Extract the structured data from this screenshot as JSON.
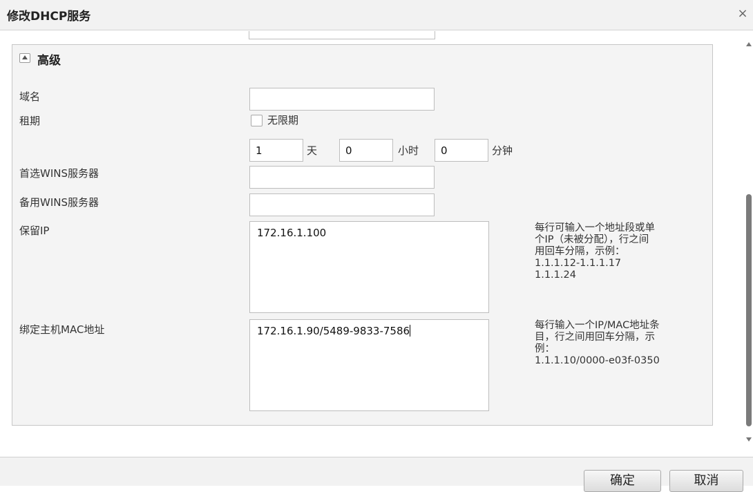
{
  "dialog": {
    "title": "修改DHCP服务",
    "close_glyph": "×"
  },
  "section": {
    "title": "高级",
    "toggle_icon": "collapse-triangle-icon"
  },
  "fields": {
    "domain": {
      "label": "域名",
      "value": ""
    },
    "lease": {
      "label": "租期",
      "unlimited_label": "无限期",
      "unlimited_checked": false,
      "days": "1",
      "days_unit": "天",
      "hours": "0",
      "hours_unit": "小时",
      "minutes": "0",
      "minutes_unit": "分钟"
    },
    "primary_wins": {
      "label": "首选WINS服务器",
      "value": ""
    },
    "backup_wins": {
      "label": "备用WINS服务器",
      "value": ""
    },
    "reserved_ip": {
      "label": "保留IP",
      "value": "172.16.1.100",
      "hint": "每行可输入一个地址段或单\n个IP（未被分配），行之间\n用回车分隔，示例：\n1.1.1.12-1.1.1.17\n1.1.1.24"
    },
    "bind_mac": {
      "label": "绑定主机MAC地址",
      "value": "172.16.1.90/5489-9833-7586",
      "hint": "每行输入一个IP/MAC地址条\n目，行之间用回车分隔，示\n例：\n1.1.1.10/0000-e03f-0350"
    }
  },
  "footer": {
    "confirm_label": "确定",
    "cancel_label": "取消"
  }
}
